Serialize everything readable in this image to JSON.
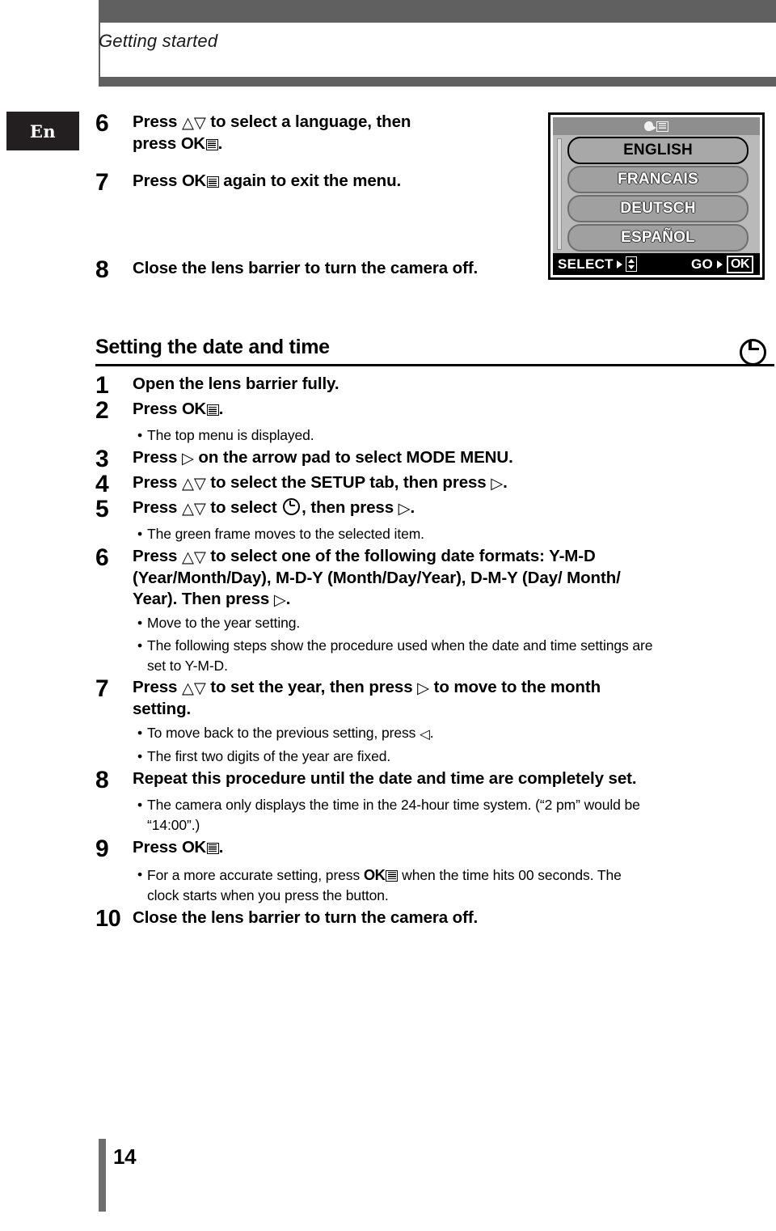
{
  "header": {
    "title": "Getting started",
    "band_color": "#606060"
  },
  "lang_badge": {
    "label": "En"
  },
  "page_number": "14",
  "glyphs": {
    "up": "△",
    "down": "▽",
    "right": "▷",
    "left": "◁",
    "ok": "OK",
    "menu_icon": "menu-icon",
    "clock_icon": "clock-icon"
  },
  "steps_top": [
    {
      "num": "6",
      "parts": [
        "Press ",
        "up",
        "down",
        " to select a language, then press ",
        "ok-menu",
        "."
      ]
    },
    {
      "num": "7",
      "parts": [
        "Press ",
        "ok-menu",
        " again to exit the menu."
      ]
    },
    {
      "num": "8",
      "parts": [
        "Close the lens barrier to turn the camera off."
      ]
    }
  ],
  "step6_line1_a": "Press ",
  "step6_line1_b": " to select a language, then",
  "step6_line2_a": "press ",
  "step6_line2_b": ".",
  "step7_a": "Press ",
  "step7_b": " again to exit the menu.",
  "step8_text": "Close the lens barrier to turn the camera off.",
  "section": {
    "title": "Setting the date and time",
    "icon": "clock-icon"
  },
  "steps": [
    {
      "num": "1",
      "text": "Open the lens barrier fully."
    },
    {
      "num": "2",
      "text_a": "Press ",
      "text_b": "."
    },
    {
      "num": "3",
      "text_a": "Press ",
      "text_b": " on the arrow pad to select MODE MENU."
    },
    {
      "num": "4",
      "text_a": "Press ",
      "text_b": " to select the SETUP tab, then press ",
      "text_c": "."
    },
    {
      "num": "5",
      "text_a": "Press ",
      "text_b": " to select ",
      "text_c": ", then press ",
      "text_d": "."
    },
    {
      "num": "6",
      "line1_a": "Press ",
      "line1_b": " to select one of the following date formats: Y-M-D",
      "line2": "(Year/Month/Day), M-D-Y (Month/Day/Year), D-M-Y (Day/ Month/",
      "line3_a": "Year). Then press ",
      "line3_b": "."
    },
    {
      "num": "7",
      "line1_a": "Press ",
      "line1_b": " to set the year, then press ",
      "line1_c": " to move to the month",
      "line2": "setting."
    },
    {
      "num": "8",
      "text": "Repeat this procedure until the date and time are completely set."
    },
    {
      "num": "9",
      "text_a": "Press ",
      "text_b": "."
    },
    {
      "num": "10",
      "text": "Close the lens barrier to turn the camera off."
    }
  ],
  "bullets": {
    "b2": "The top menu is displayed.",
    "b5": "The green frame moves to the selected item.",
    "b6a": "Move to the year setting.",
    "b6b_line1": "The following steps show the procedure used when the date and time settings are",
    "b6b_line2": "set to Y-M-D.",
    "b7a_a": "To move back to the previous setting, press ",
    "b7a_b": ".",
    "b7b": "The first two digits of the year are fixed.",
    "b8_line1": "The camera only displays the time in the 24-hour time system. (“2 pm” would be",
    "b8_line2": "“14:00”.)",
    "b9_line1_a": "For a more accurate setting, press ",
    "b9_line1_b": " when the time hits 00 seconds. The",
    "b9_line2": "clock starts when you press the button.",
    "bullet_char": "•"
  },
  "lcd": {
    "top_icons": [
      "speech-head-icon",
      "list-icon"
    ],
    "languages": [
      {
        "label": "ENGLISH",
        "selected": true
      },
      {
        "label": "FRANCAIS",
        "selected": false
      },
      {
        "label": "DEUTSCH",
        "selected": false
      },
      {
        "label": "ESPAÑOL",
        "selected": false
      }
    ],
    "bottom_left_label": "SELECT",
    "bottom_right_label": "GO",
    "ok_label": "OK"
  }
}
